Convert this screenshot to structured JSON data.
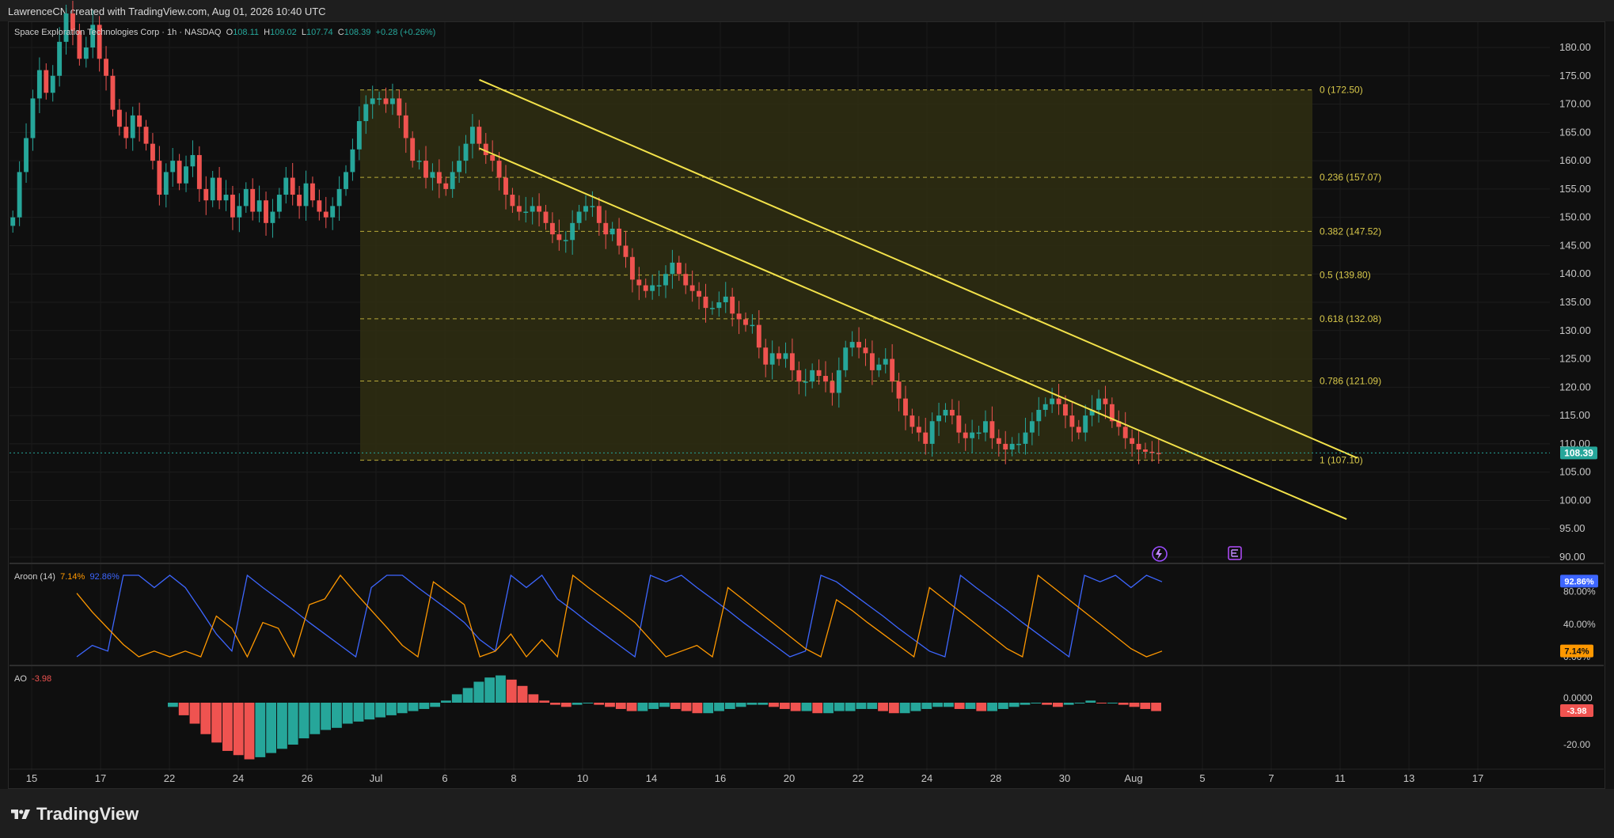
{
  "watermark": "LawrenceCN created with TradingView.com, Aug 01, 2026 10:40 UTC",
  "brand": "TradingView",
  "header": {
    "symbol": "Space Exploration Technologies Corp · 1h · NASDAQ",
    "o_label": "O",
    "o_value": "108.11",
    "h_label": "H",
    "h_value": "109.02",
    "l_label": "L",
    "l_value": "107.74",
    "c_label": "C",
    "c_value": "108.39",
    "change": "+0.28 (+0.26%)"
  },
  "colors": {
    "up": "#26a69a",
    "down": "#ef5350",
    "channel": "#f3e24a",
    "fib_zone": "#2f2e12",
    "aroon_up": "#ff9800",
    "aroon_down": "#3d66ff",
    "price_tag": "#26a69a",
    "ao_tag": "#ef5350"
  },
  "chart_data": {
    "type": "candlestick",
    "timeframe": "1h",
    "y_axis": {
      "range": [
        90,
        180
      ],
      "ticks": [
        "180.00",
        "175.00",
        "170.00",
        "165.00",
        "160.00",
        "155.00",
        "150.00",
        "145.00",
        "140.00",
        "135.00",
        "130.00",
        "125.00",
        "120.00",
        "115.00",
        "110.00",
        "105.00",
        "100.00",
        "95.00",
        "90.00"
      ]
    },
    "x_axis": {
      "ticks": [
        "15",
        "17",
        "22",
        "24",
        "26",
        "Jul",
        "6",
        "8",
        "10",
        "14",
        "16",
        "20",
        "22",
        "24",
        "28",
        "30",
        "Aug",
        "5",
        "7",
        "11",
        "13",
        "17"
      ]
    },
    "last_price": "108.39",
    "fibonacci": [
      {
        "label": "0 (172.50)",
        "value": 172.5
      },
      {
        "label": "0.236 (157.07)",
        "value": 157.07
      },
      {
        "label": "0.382 (147.52)",
        "value": 147.52
      },
      {
        "label": "0.5 (139.80)",
        "value": 139.8
      },
      {
        "label": "0.618 (132.08)",
        "value": 132.08
      },
      {
        "label": "0.786 (121.09)",
        "value": 121.09
      },
      {
        "label": "1 (107.10)",
        "value": 107.1
      }
    ],
    "channel": {
      "upper": [
        [
          0.305,
          174.3
        ],
        [
          0.875,
          107.5
        ]
      ],
      "lower": [
        [
          0.305,
          162.2
        ],
        [
          0.868,
          96.7
        ]
      ]
    },
    "closes": [
      150,
      158,
      164,
      171,
      176,
      172,
      175,
      181,
      186,
      183,
      178,
      180,
      184,
      178,
      175,
      169,
      166,
      164,
      168,
      166,
      163,
      160,
      154,
      158,
      160,
      156,
      159,
      161,
      155,
      153,
      157,
      153,
      154,
      150,
      152,
      155,
      151,
      153,
      149,
      151,
      154,
      157,
      154,
      152,
      156,
      153,
      151,
      150,
      152,
      155,
      158,
      162,
      167,
      170,
      171,
      171,
      170,
      171,
      168,
      164,
      160,
      160,
      157,
      158,
      156,
      155,
      158,
      160,
      163,
      166,
      163,
      161,
      160,
      157,
      154,
      152,
      151,
      151,
      152,
      151,
      149,
      147,
      146,
      146,
      149,
      151,
      152,
      152,
      149,
      147,
      148,
      145,
      143,
      139,
      138,
      137,
      138,
      138,
      140,
      142,
      140,
      138,
      137,
      136,
      134,
      134,
      135,
      136,
      133,
      132,
      131,
      131,
      127,
      124,
      126,
      125,
      126,
      123,
      121,
      121,
      123,
      122,
      121,
      119,
      123,
      127,
      128,
      127,
      126,
      123,
      124,
      125,
      121,
      118,
      115,
      113,
      112,
      110,
      114,
      115,
      116,
      115,
      112,
      111,
      112,
      112,
      114,
      111,
      110,
      109,
      110,
      110,
      112,
      114,
      116,
      117,
      118,
      117,
      115,
      113,
      112,
      115,
      116,
      118,
      117,
      114,
      113,
      111,
      110,
      109,
      108.6,
      108.4,
      108.39
    ],
    "aroon": {
      "label": "Aroon (14)",
      "up_value": "7.14%",
      "down_value": "92.86%",
      "axis_ticks": [
        "80.00%",
        "40.00%",
        "0.00%"
      ],
      "up_series": [
        78,
        55,
        35,
        15,
        0,
        7,
        0,
        7,
        0,
        50,
        35,
        0,
        42,
        35,
        0,
        64,
        71,
        100,
        78,
        57,
        36,
        14,
        0,
        92,
        78,
        64,
        0,
        7,
        28,
        0,
        21,
        0,
        100,
        85,
        71,
        57,
        42,
        21,
        0,
        7,
        14,
        0,
        85,
        70,
        55,
        40,
        25,
        10,
        0,
        70,
        57,
        42,
        28,
        14,
        0,
        85,
        70,
        55,
        40,
        25,
        10,
        0,
        100,
        85,
        70,
        55,
        40,
        25,
        10,
        0,
        7
      ],
      "down_series": [
        0,
        14,
        7,
        100,
        100,
        85,
        100,
        85,
        57,
        28,
        7,
        100,
        85,
        71,
        57,
        42,
        28,
        14,
        0,
        85,
        100,
        100,
        85,
        71,
        57,
        42,
        21,
        7,
        100,
        85,
        100,
        71,
        57,
        42,
        28,
        14,
        0,
        100,
        92,
        100,
        85,
        71,
        57,
        42,
        28,
        14,
        0,
        7,
        100,
        92,
        78,
        64,
        50,
        35,
        21,
        7,
        0,
        100,
        85,
        71,
        57,
        42,
        28,
        14,
        0,
        100,
        92,
        100,
        85,
        100,
        92
      ]
    },
    "ao": {
      "label": "AO",
      "value": "-3.98",
      "axis_ticks": [
        "0.0000",
        "-20.00"
      ],
      "series": [
        -2,
        -6,
        -10,
        -15,
        -19,
        -23,
        -25,
        -27,
        -26,
        -24,
        -22,
        -20,
        -17,
        -15,
        -13,
        -12,
        -10,
        -9,
        -8,
        -7,
        -6,
        -5,
        -4,
        -3,
        -2,
        1,
        4,
        7,
        10,
        12,
        13,
        11,
        8,
        4,
        1,
        -1,
        -2,
        -1,
        0,
        -1,
        -2,
        -3,
        -4,
        -4,
        -3,
        -2,
        -3,
        -4,
        -5,
        -5,
        -4,
        -3,
        -2,
        -1,
        -1,
        -2,
        -3,
        -4,
        -4,
        -5,
        -5,
        -4,
        -4,
        -3,
        -3,
        -4,
        -5,
        -5,
        -4,
        -3,
        -2,
        -2,
        -3,
        -3,
        -4,
        -4,
        -3,
        -2,
        -1,
        0,
        -1,
        -2,
        -1,
        0,
        1,
        0,
        0,
        -1,
        -2,
        -3,
        -4
      ]
    }
  }
}
